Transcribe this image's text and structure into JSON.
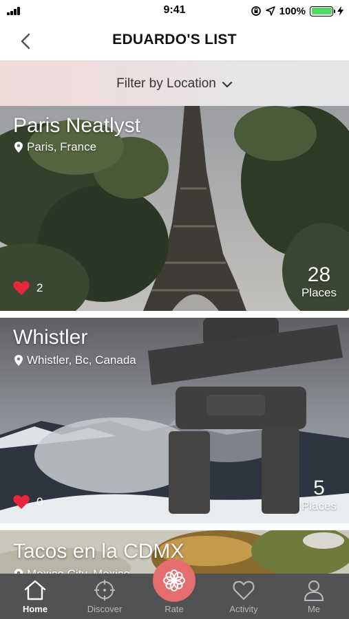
{
  "status_bar": {
    "time": "9:41",
    "battery": "100%",
    "battery_level": 1.0
  },
  "header": {
    "title": "EDUARDO'S LIST",
    "back_icon": "chevron-left-icon"
  },
  "filter": {
    "label": "Filter by Location",
    "icon": "chevron-down-icon"
  },
  "lists": [
    {
      "title": "Paris Neatlyst",
      "location": "Paris, France",
      "likes": "2",
      "places_count": "28",
      "places_label": "Places"
    },
    {
      "title": "Whistler",
      "location": "Whistler, Bc, Canada",
      "likes": "0",
      "places_count": "5",
      "places_label": "Places"
    },
    {
      "title": "Tacos en la CDMX",
      "location": "Mexico City, Mexico"
    }
  ],
  "tabbar": {
    "tabs": [
      {
        "label": "Home",
        "icon": "home-icon",
        "active": true
      },
      {
        "label": "Discover",
        "icon": "crosshair-icon",
        "active": false
      },
      {
        "label": "Rate",
        "icon": "flower-icon",
        "active": false
      },
      {
        "label": "Activity",
        "icon": "heart-outline-icon",
        "active": false
      },
      {
        "label": "Me",
        "icon": "user-icon",
        "active": false
      }
    ]
  },
  "colors": {
    "accent": "#e46d6d",
    "heart": "#e8283a",
    "tabbar": "#505254",
    "battery": "#4cd964"
  }
}
